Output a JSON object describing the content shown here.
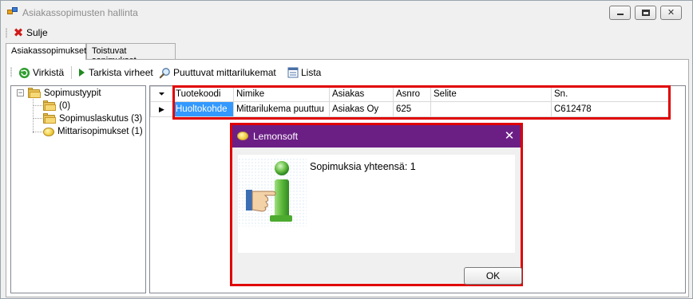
{
  "window": {
    "title": "Asiakassopimusten hallinta"
  },
  "toolbar": {
    "close_label": "Sulje"
  },
  "tabs": [
    {
      "label": "Asiakassopimukset",
      "active": true
    },
    {
      "label": "Toistuvat sopimukset",
      "active": false
    }
  ],
  "actions": {
    "refresh_label": "Virkistä",
    "check_errors_label": "Tarkista virheet",
    "missing_readings_label": "Puuttuvat mittarilukemat",
    "list_label": "Lista"
  },
  "tree": {
    "root": "Sopimustyypit",
    "children": [
      {
        "label": "(0)"
      },
      {
        "label": "Sopimuslaskutus (3)"
      },
      {
        "label": "Mittarisopimukset (1)"
      }
    ]
  },
  "grid": {
    "columns": [
      "Tuotekoodi",
      "Nimike",
      "Asiakas",
      "Asnro",
      "Selite",
      "Sn."
    ],
    "rows": [
      [
        "Huoltokohde",
        "Mittarilukema puuttuu",
        "Asiakas Oy",
        "625",
        "",
        "C612478"
      ]
    ],
    "row_marker": "▶",
    "filter_glyph": "⏷"
  },
  "dialog": {
    "title": "Lemonsoft",
    "message": "Sopimuksia yhteensä: 1",
    "ok_label": "OK",
    "close_glyph": "✕"
  },
  "colors": {
    "dialog_title_bg": "#6b1f85",
    "highlight_frame": "#e00000",
    "selection": "#3399ff"
  },
  "icons": {
    "close_toolbar": "x-icon",
    "refresh": "refresh-icon",
    "check_errors": "play-arrow-icon",
    "missing_readings": "magnifier-icon",
    "list": "list-icon",
    "info": "info-hand-icon"
  }
}
